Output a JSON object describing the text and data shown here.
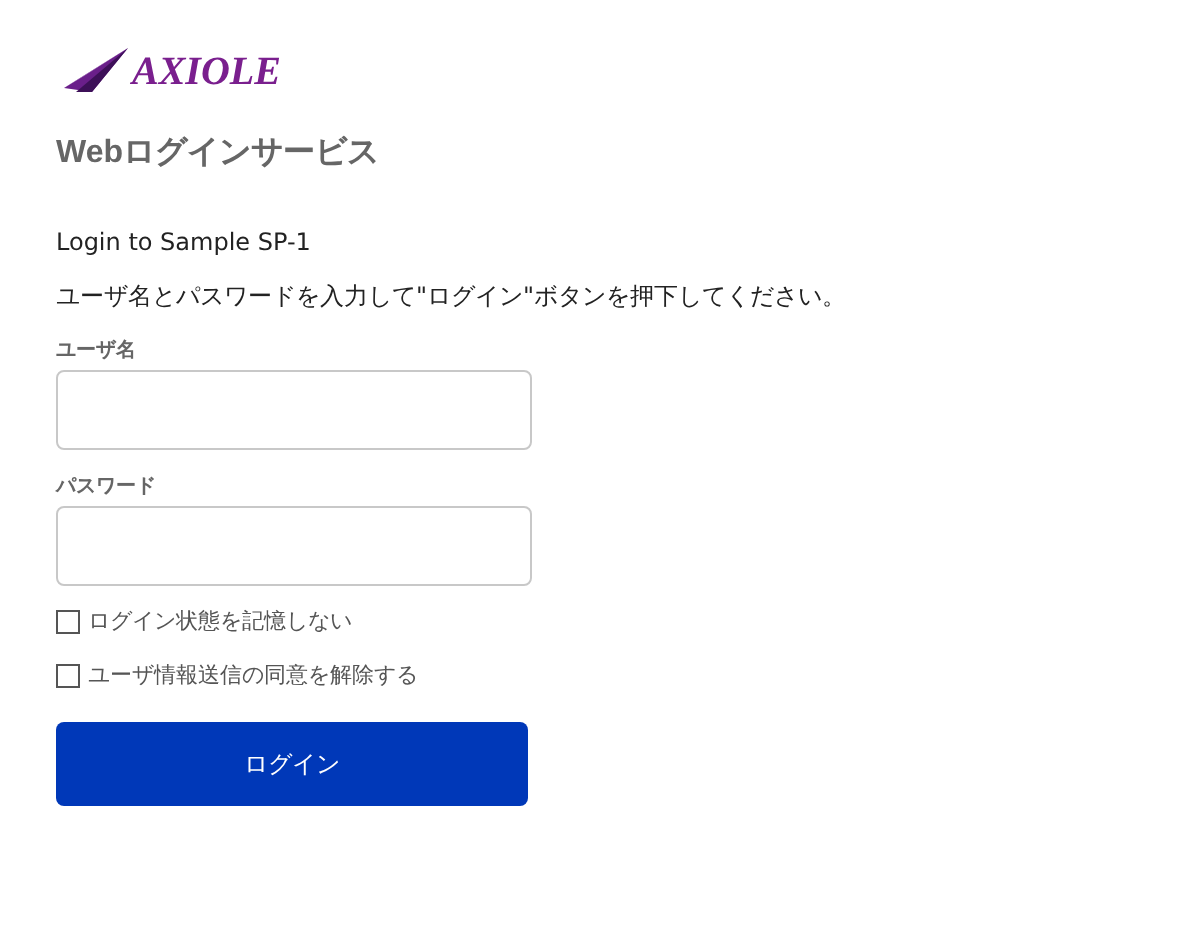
{
  "logo": {
    "text": "AXIOLE"
  },
  "heading": "Webログインサービス",
  "subtitle": "Login to Sample SP-1",
  "instruction": "ユーザ名とパスワードを入力して\"ログイン\"ボタンを押下してください。",
  "fields": [
    {
      "label": "ユーザ名"
    },
    {
      "label": "パスワード"
    }
  ],
  "options": [
    {
      "label": "ログイン状態を記憶しない",
      "checked": false
    },
    {
      "label": "ユーザ情報送信の同意を解除する",
      "checked": false
    }
  ],
  "button": "ログイン"
}
